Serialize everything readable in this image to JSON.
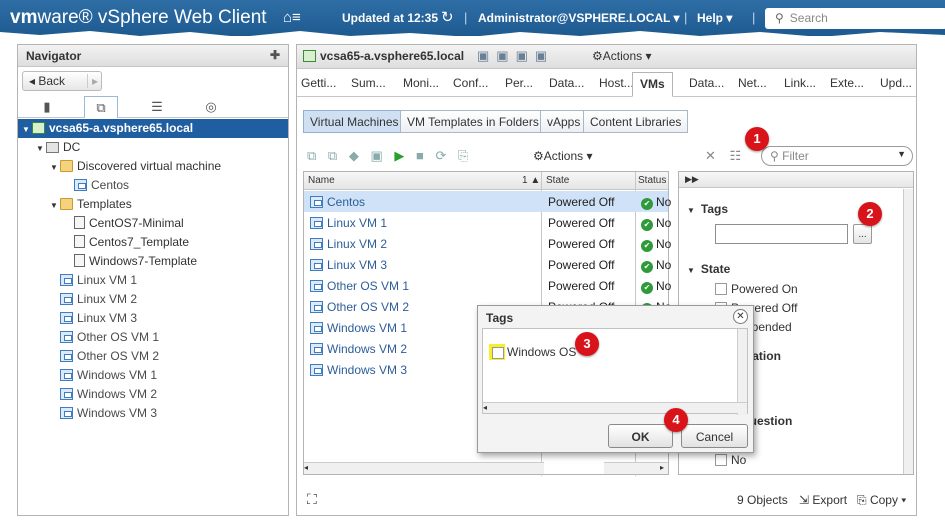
{
  "topbar": {
    "brand_vm": "vm",
    "brand_rest": "ware® vSphere Web Client",
    "home_icon": "home-icon",
    "updated": "Updated at 12:35",
    "user": "Administrator@VSPHERE.LOCAL ▾",
    "help": "Help ▾",
    "search_placeholder": "Search"
  },
  "navigator": {
    "title": "Navigator",
    "back": "Back",
    "tabs": [
      "hosts-clusters-icon",
      "vms-templates-icon",
      "storage-icon",
      "networking-icon"
    ],
    "tree": [
      {
        "label": "vcsa65-a.vsphere65.local",
        "icon": "vcenter-icon",
        "level": 0,
        "twisty": "▼",
        "selected": true
      },
      {
        "label": "DC",
        "icon": "datacenter-icon",
        "level": 1,
        "twisty": "▼"
      },
      {
        "label": "Discovered virtual machine",
        "icon": "folder-icon",
        "level": 2,
        "twisty": "▼"
      },
      {
        "label": "Centos",
        "icon": "vm-icon",
        "level": 3
      },
      {
        "label": "Templates",
        "icon": "folder-icon",
        "level": 2,
        "twisty": "▼"
      },
      {
        "label": "CentOS7-Minimal",
        "icon": "template-icon",
        "level": 3
      },
      {
        "label": "Centos7_Template",
        "icon": "template-icon",
        "level": 3
      },
      {
        "label": "Windows7-Template",
        "icon": "template-icon",
        "level": 3
      },
      {
        "label": "Linux VM 1",
        "icon": "vm-icon",
        "level": 2
      },
      {
        "label": "Linux VM 2",
        "icon": "vm-icon",
        "level": 2
      },
      {
        "label": "Linux VM 3",
        "icon": "vm-icon",
        "level": 2
      },
      {
        "label": "Other OS VM 1",
        "icon": "vm-icon",
        "level": 2
      },
      {
        "label": "Other OS VM 2",
        "icon": "vm-icon",
        "level": 2
      },
      {
        "label": "Windows VM 1",
        "icon": "vm-icon",
        "level": 2
      },
      {
        "label": "Windows VM 2",
        "icon": "vm-icon",
        "level": 2
      },
      {
        "label": "Windows VM 3",
        "icon": "vm-icon",
        "level": 2
      }
    ]
  },
  "main": {
    "object": "vcsa65-a.vsphere65.local",
    "actions": "Actions ▾",
    "tabs": [
      "Getti...",
      "Sum...",
      "Moni...",
      "Conf...",
      "Per...",
      "Data...",
      "Host...",
      "VMs",
      "Data...",
      "Net...",
      "Link...",
      "Exte...",
      "Upd..."
    ],
    "active_tab": "VMs",
    "subtabs": [
      "Virtual Machines",
      "VM Templates in Folders",
      "vApps",
      "Content Libraries"
    ],
    "toolbar_actions": "Actions ▾",
    "filter_placeholder": "Filter",
    "columns": {
      "name": "Name",
      "sort": "1 ▲",
      "state": "State",
      "status": "Status"
    },
    "rows": [
      {
        "name": "Centos",
        "state": "Powered Off",
        "status": "No"
      },
      {
        "name": "Linux VM 1",
        "state": "Powered Off",
        "status": "No"
      },
      {
        "name": "Linux VM 2",
        "state": "Powered Off",
        "status": "No"
      },
      {
        "name": "Linux VM 3",
        "state": "Powered Off",
        "status": "No"
      },
      {
        "name": "Other OS VM 1",
        "state": "Powered Off",
        "status": "No"
      },
      {
        "name": "Other OS VM 2",
        "state": "Powered Off",
        "status": "No"
      },
      {
        "name": "Windows VM 1",
        "state": "",
        "status": ""
      },
      {
        "name": "Windows VM 2",
        "state": "",
        "status": ""
      },
      {
        "name": "Windows VM 3",
        "state": "",
        "status": ""
      }
    ],
    "status_bar": {
      "count": "9 Objects",
      "export": "Export",
      "copy": "Copy ▾"
    }
  },
  "filter_panel": {
    "tags_title": "Tags",
    "tags_button": "...",
    "state_title": "State",
    "state_options": [
      "Powered On",
      "Powered Off",
      "Suspended"
    ],
    "consolidation_title": "Consolidation",
    "question_title": "Needs Question",
    "no_option": "No"
  },
  "dialog": {
    "title": "Tags",
    "item": "Windows OS",
    "ok": "OK",
    "cancel": "Cancel"
  },
  "callouts": [
    "1",
    "2",
    "3",
    "4"
  ],
  "colors": {
    "header_blue": "#1d5a90",
    "selection": "#1f5ea0",
    "callout_red": "#d8141a",
    "highlight_yellow": "#f5ef2c"
  }
}
